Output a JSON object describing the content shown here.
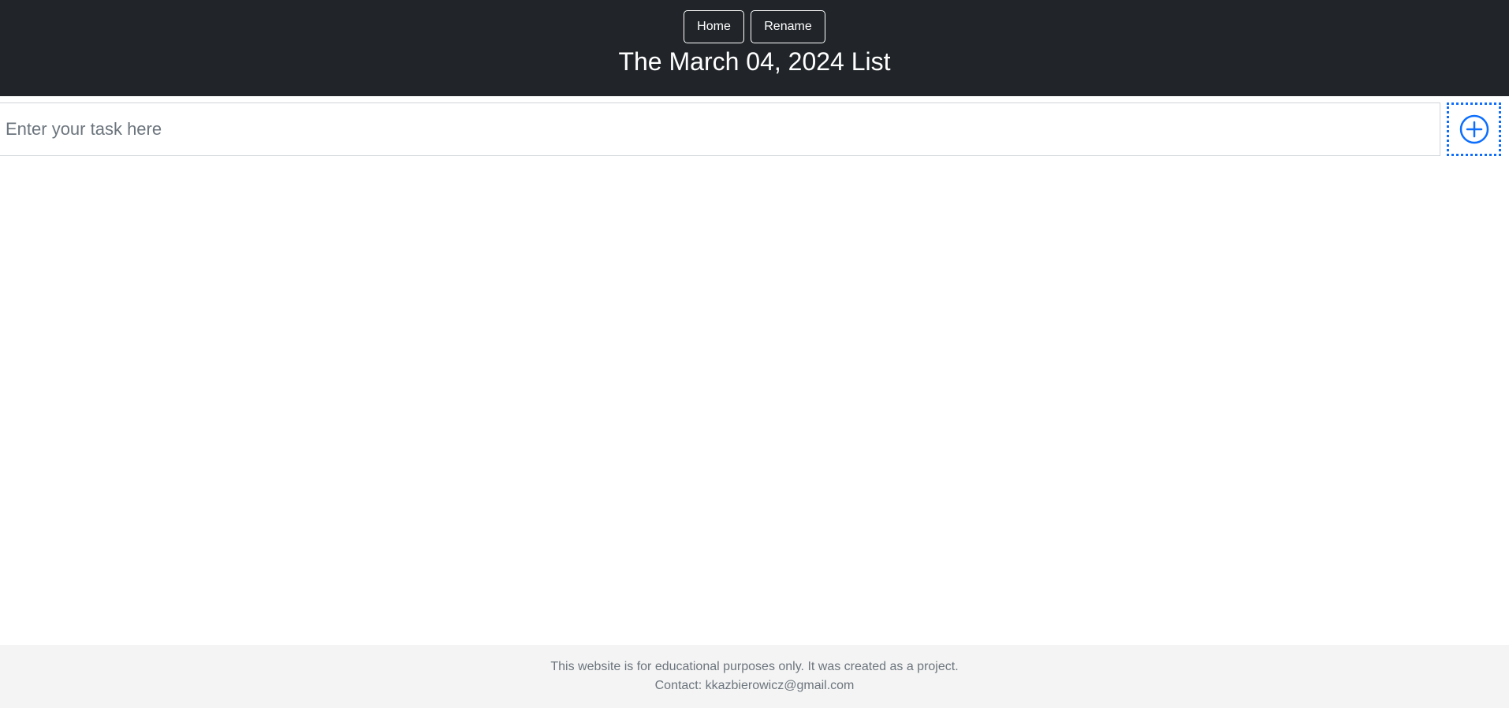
{
  "header": {
    "nav": {
      "home_label": "Home",
      "rename_label": "Rename"
    },
    "title": "The March 04, 2024 List"
  },
  "task_entry": {
    "placeholder": "Enter your task here",
    "value": "",
    "add_icon": "plus-circle-icon"
  },
  "footer": {
    "disclaimer": "This website is for educational purposes only. It was created as a project.",
    "contact": "Contact: kkazbierowicz@gmail.com"
  },
  "colors": {
    "header_bg": "#212529",
    "accent": "#0d6efd",
    "footer_bg": "#f4f4f4",
    "muted_text": "#6c757d"
  }
}
